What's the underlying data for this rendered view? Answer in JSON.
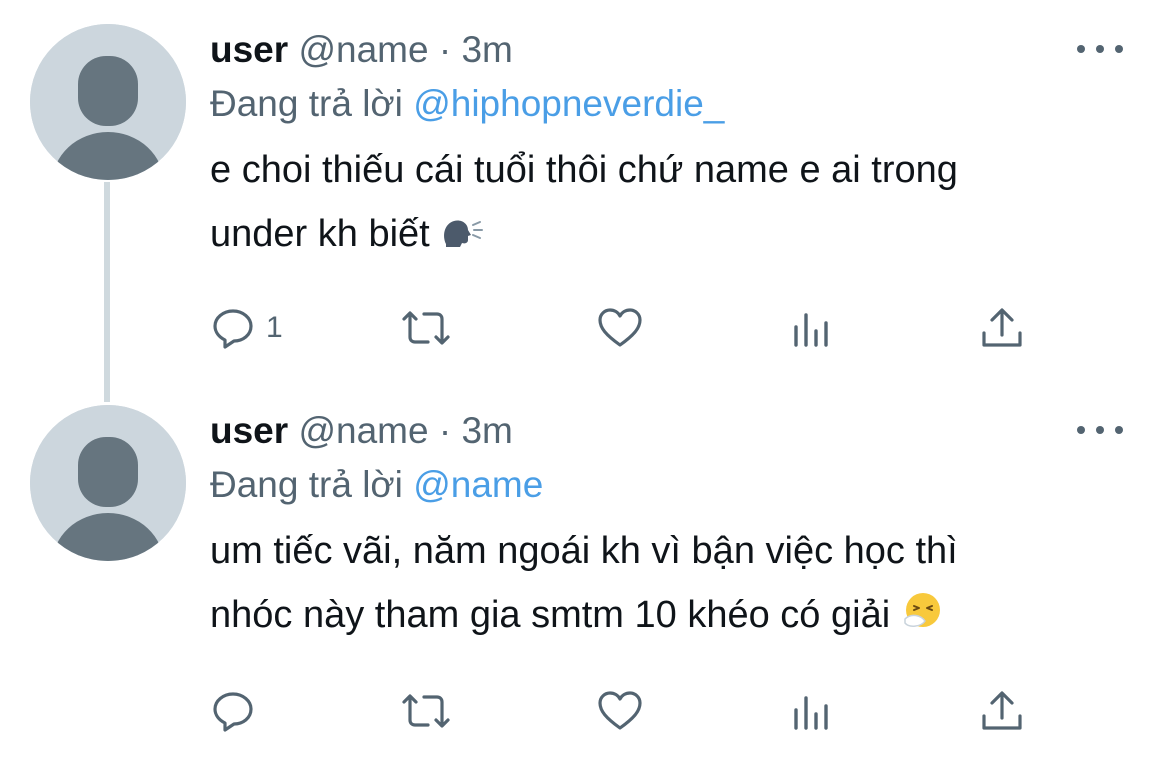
{
  "colors": {
    "text": "#0f1419",
    "secondary": "#536471",
    "mention": "#4a9ee6",
    "avatar_bg": "#ccd6dd",
    "avatar_fg": "#66757f",
    "thread_line": "#cfd9de"
  },
  "tweets": [
    {
      "username": "user",
      "handle": "@name",
      "dot": "·",
      "time": "3m",
      "replying_prefix": "Đang trả lời",
      "replying_to": "@hiphopneverdie_",
      "text_line1": "e choi thiếu cái tuổi thôi chứ name e ai trong",
      "text_line2": "under kh biết",
      "emoji": "speaking-head-emoji",
      "reply_count": "1",
      "icons": [
        "reply-icon",
        "retweet-icon",
        "like-icon",
        "analytics-icon",
        "share-icon",
        "more-icon"
      ]
    },
    {
      "username": "user",
      "handle": "@name",
      "dot": "·",
      "time": "3m",
      "replying_prefix": "Đang trả lời",
      "replying_to": "@name",
      "text_line1": "um tiếc vãi, năm ngoái kh vì bận việc học thì",
      "text_line2": "nhóc này tham gia smtm 10 khéo có giải",
      "emoji": "sneezing-face-emoji",
      "reply_count": "",
      "icons": [
        "reply-icon",
        "retweet-icon",
        "like-icon",
        "analytics-icon",
        "share-icon",
        "more-icon"
      ]
    }
  ]
}
